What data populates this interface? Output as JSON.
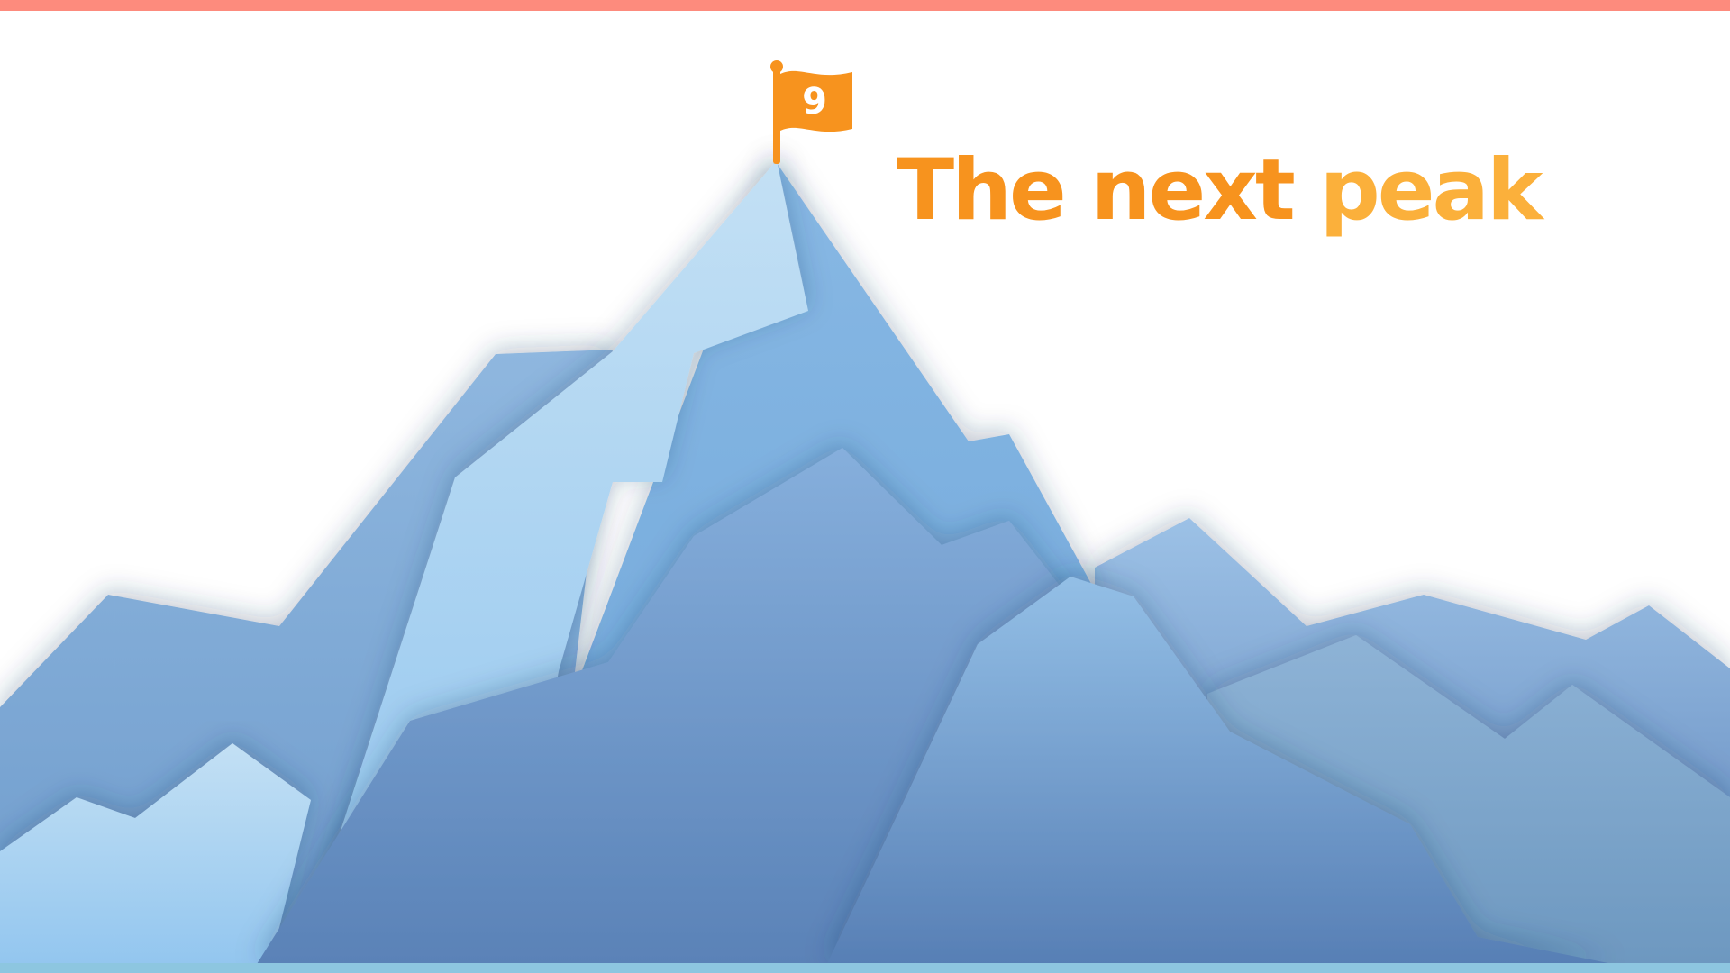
{
  "slide": {
    "title_part1": "The next peak",
    "title_part2": "",
    "flag_number": "9"
  },
  "colors": {
    "top_stripe": "#fd8b7d",
    "bottom_stripe": "#8dc6e0",
    "title_orange_dark": "#f7931e",
    "title_orange_light": "#fbb03b",
    "flag": "#f7931e",
    "mountain_light": "#b9dbf3",
    "mountain_mid": "#7fb2de",
    "mountain_dark": "#5a82b7"
  },
  "icons": {
    "flag": "flag-icon",
    "mountains": "mountain-range-illustration"
  }
}
